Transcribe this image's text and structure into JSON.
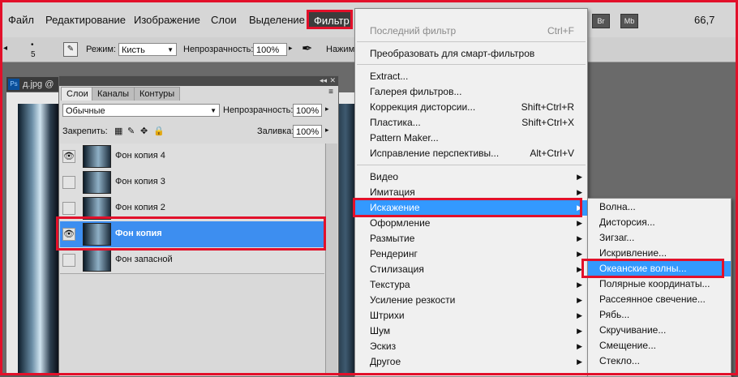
{
  "menubar": {
    "items": [
      "Файл",
      "Редактирование",
      "Изображение",
      "Слои",
      "Выделение"
    ],
    "active_item": "Фильтр",
    "right_buttons": [
      "Br",
      "Mb"
    ],
    "zoom": "66,7"
  },
  "options_bar": {
    "brush_size": "5",
    "mode_label": "Режим:",
    "mode_value": "Кисть",
    "opacity_label": "Непрозрачность:",
    "opacity_value": "100%",
    "press_label": "Нажим"
  },
  "document": {
    "tab_title": "д.jpg @"
  },
  "layers_panel": {
    "tabs": [
      "Слои",
      "Каналы",
      "Контуры"
    ],
    "blend_mode": "Обычные",
    "opacity_label": "Непрозрачность:",
    "opacity_value": "100%",
    "lock_label": "Закрепить:",
    "fill_label": "Заливка:",
    "fill_value": "100%",
    "layers": [
      {
        "name": "Фон копия 4",
        "visible": true,
        "selected": false
      },
      {
        "name": "Фон копия 3",
        "visible": false,
        "selected": false
      },
      {
        "name": "Фон копия 2",
        "visible": false,
        "selected": false
      },
      {
        "name": "Фон копия",
        "visible": true,
        "selected": true
      },
      {
        "name": "Фон запасной",
        "visible": false,
        "selected": false
      }
    ]
  },
  "filter_menu": {
    "items": [
      {
        "label": "Последний фильтр",
        "shortcut": "Ctrl+F",
        "disabled": true
      },
      {
        "label": "Преобразовать для смарт-фильтров",
        "shortcut": ""
      },
      {
        "label": "Extract...",
        "shortcut": ""
      },
      {
        "label": "Галерея фильтров...",
        "shortcut": ""
      },
      {
        "label": "Коррекция дисторсии...",
        "shortcut": "Shift+Ctrl+R"
      },
      {
        "label": "Пластика...",
        "shortcut": "Shift+Ctrl+X"
      },
      {
        "label": "Pattern Maker...",
        "shortcut": ""
      },
      {
        "label": "Исправление перспективы...",
        "shortcut": "Alt+Ctrl+V"
      },
      {
        "label": "Видео",
        "shortcut": ""
      },
      {
        "label": "Имитация",
        "shortcut": ""
      },
      {
        "label": "Искажение",
        "shortcut": ""
      },
      {
        "label": "Оформление",
        "shortcut": ""
      },
      {
        "label": "Размытие",
        "shortcut": ""
      },
      {
        "label": "Рендеринг",
        "shortcut": ""
      },
      {
        "label": "Стилизация",
        "shortcut": ""
      },
      {
        "label": "Текстура",
        "shortcut": ""
      },
      {
        "label": "Усиление резкости",
        "shortcut": ""
      },
      {
        "label": "Штрихи",
        "shortcut": ""
      },
      {
        "label": "Шум",
        "shortcut": ""
      },
      {
        "label": "Эскиз",
        "shortcut": ""
      },
      {
        "label": "Другое",
        "shortcut": ""
      }
    ]
  },
  "distort_submenu": {
    "items": [
      "Волна...",
      "Дисторсия...",
      "Зигзаг...",
      "Искривление...",
      "Океанские волны...",
      "Полярные координаты...",
      "Рассеянное свечение...",
      "Рябь...",
      "Скручивание...",
      "Смещение...",
      "Стекло..."
    ]
  },
  "colors": {
    "highlight": "#3399ff",
    "annotation_red": "#e2102a"
  }
}
